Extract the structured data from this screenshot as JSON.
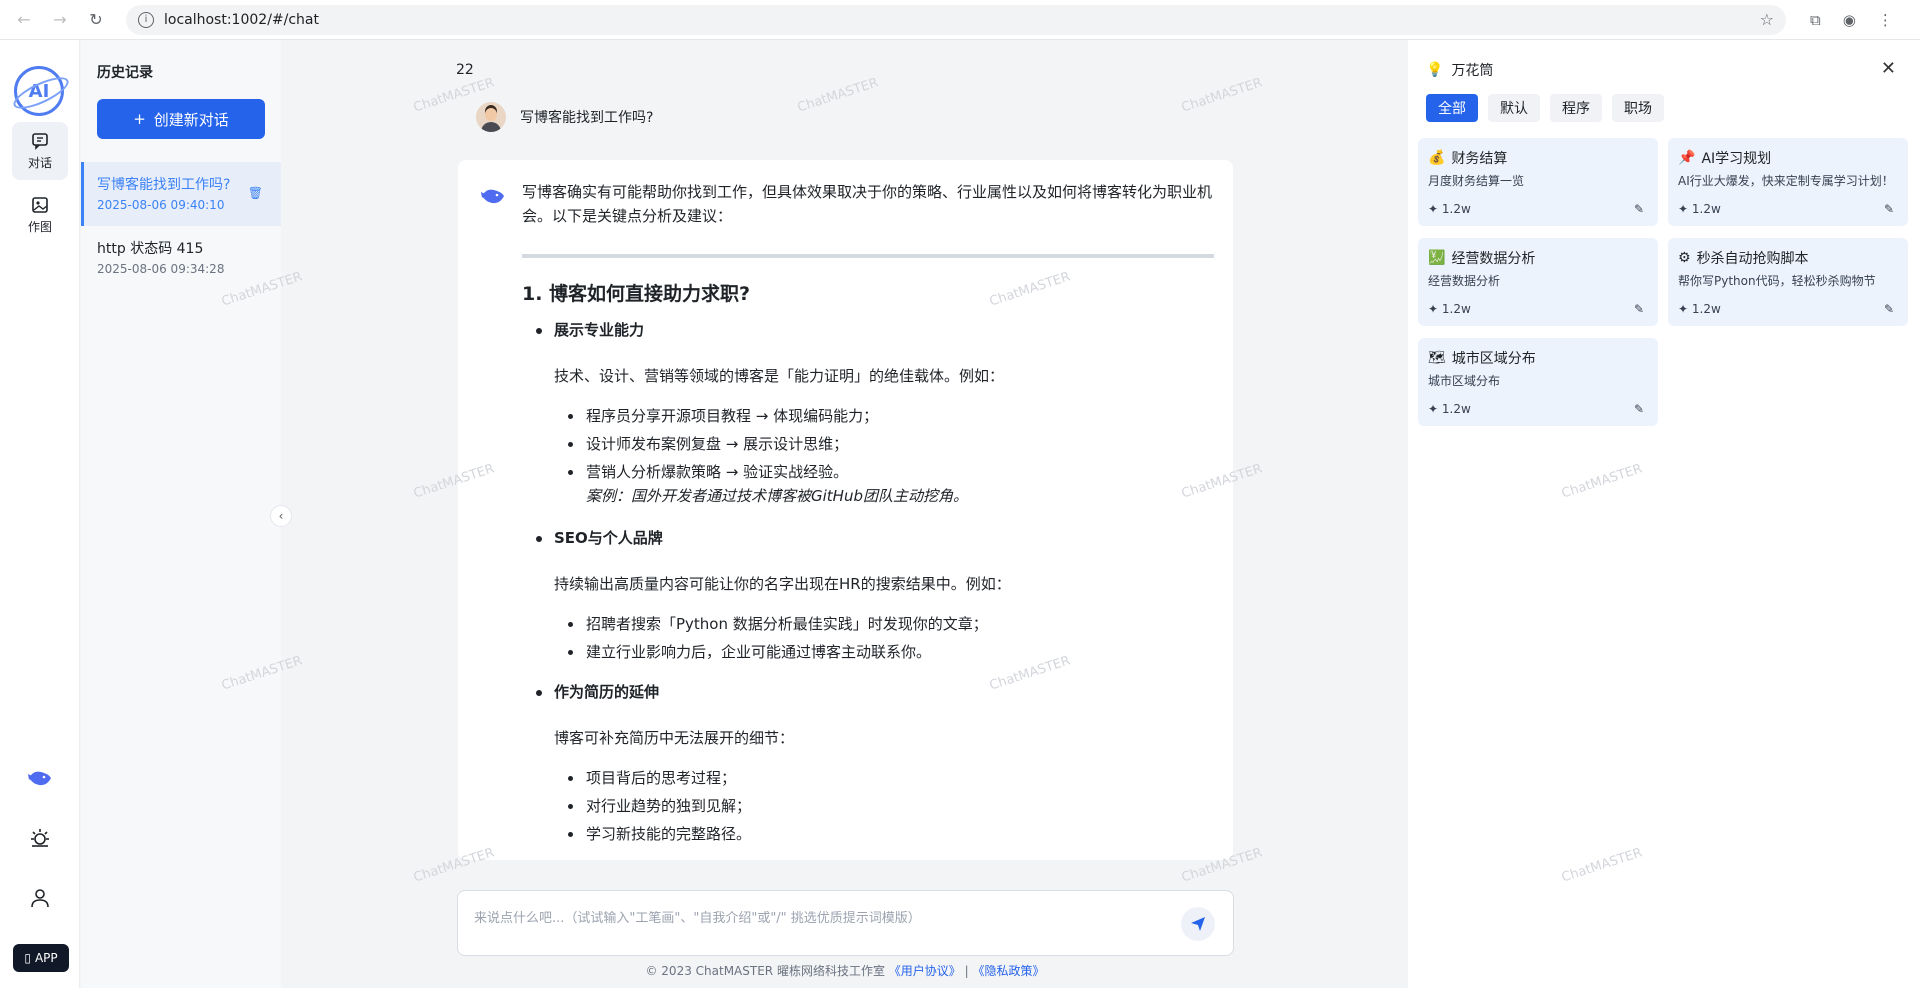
{
  "browser": {
    "url": "localhost:1002/#/chat"
  },
  "rail": {
    "items": [
      {
        "label": "对话"
      },
      {
        "label": "作图"
      }
    ],
    "app_label": "APP"
  },
  "history": {
    "title": "历史记录",
    "new_chat_label": "创建新对话",
    "items": [
      {
        "title": "写博客能找到工作吗?",
        "date": "2025-08-06 09:40:10"
      },
      {
        "title": "http 状态码 415",
        "date": "2025-08-06 09:34:28"
      }
    ]
  },
  "chat": {
    "counter": "22",
    "user_message": "写博客能找到工作吗?",
    "answer": {
      "intro": "写博客确实有可能帮助你找到工作，但具体效果取决于你的策略、行业属性以及如何将博客转化为职业机会。以下是关键点分析及建议：",
      "heading": "1. 博客如何直接助力求职?",
      "sections": [
        {
          "title": "展示专业能力",
          "desc": "技术、设计、营销等领域的博客是「能力证明」的绝佳载体。例如：",
          "items": [
            "程序员分享开源项目教程 → 体现编码能力；",
            "设计师发布案例复盘 → 展示设计思维；",
            "营销人分析爆款策略 → 验证实战经验。"
          ],
          "example": "案例：国外开发者通过技术博客被GitHub团队主动挖角。"
        },
        {
          "title": "SEO与个人品牌",
          "desc": "持续输出高质量内容可能让你的名字出现在HR的搜索结果中。例如：",
          "items": [
            "招聘者搜索「Python 数据分析最佳实践」时发现你的文章；",
            "建立行业影响力后，企业可能通过博客主动联系你。"
          ]
        },
        {
          "title": "作为简历的延伸",
          "desc": "博客可补充简历中无法展开的细节：",
          "items": [
            "项目背后的思考过程；",
            "对行业趋势的独到见解；",
            "学习新技能的完整路径。"
          ]
        }
      ]
    },
    "input_placeholder": "来说点什么吧...（试试输入\"工笔画\"、\"自我介绍\"或\"/\" 挑选优质提示词模版）",
    "footer": {
      "copyright": "© 2023 ChatMASTER 曜栋网络科技工作室",
      "user_agreement": "《用户协议》",
      "separator": "|",
      "privacy": "《隐私政策》"
    }
  },
  "prompts": {
    "title": "万花筒",
    "tabs": [
      "全部",
      "默认",
      "程序",
      "职场"
    ],
    "cards": [
      {
        "emoji": "💰",
        "title": "财务结算",
        "desc": "月度财务结算一览",
        "count": "1.2w"
      },
      {
        "emoji": "📌",
        "title": "AI学习规划",
        "desc": "AI行业大爆发，快来定制专属学习计划！",
        "count": "1.2w"
      },
      {
        "emoji": "💹",
        "title": "经营数据分析",
        "desc": "经营数据分析",
        "count": "1.2w"
      },
      {
        "emoji": "⚙",
        "title": "秒杀自动抢购脚本",
        "desc": "帮你写Python代码，轻松秒杀购物节",
        "count": "1.2w"
      },
      {
        "emoji": "🗺",
        "title": "城市区域分布",
        "desc": "城市区域分布",
        "count": "1.2w"
      }
    ]
  },
  "watermark": "ChatMASTER"
}
